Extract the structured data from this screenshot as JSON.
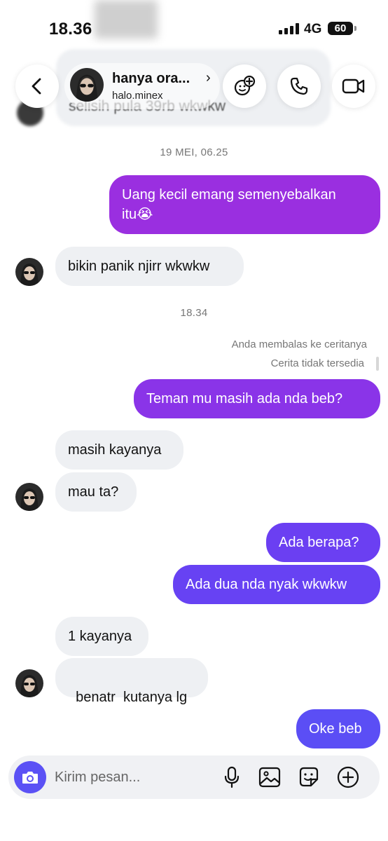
{
  "status": {
    "time": "18.36",
    "network": "4G",
    "battery": "60"
  },
  "header": {
    "name": "hanya ora...",
    "username": "halo.minex",
    "back_icon": "chevron-left-icon",
    "group_icon": "add-people-icon",
    "call_icon": "phone-icon",
    "video_icon": "video-camera-icon"
  },
  "previous_message_partial": "selisih pula 39rb wkwkw",
  "messages": {
    "ts1": "19 MEI, 06.25",
    "m1": "Uang kecil emang semenyebalkan",
    "m1b": "itu😭",
    "m2": "bikin panik njirr wkwkw",
    "ts2": "18.34",
    "note1": "Anda membalas ke ceritanya",
    "note2": "Cerita tidak tersedia",
    "m3": "Teman mu masih ada nda beb?",
    "m4": "masih kayanya",
    "m5": "mau ta?",
    "m6": "Ada berapa?",
    "m7": "Ada dua nda nyak wkwkw",
    "m8": "1 kayanya",
    "m9": "benatr  kutanya lg",
    "m10": "Oke beb"
  },
  "composer": {
    "placeholder": "Kirim pesan...",
    "camera_icon": "camera-icon",
    "mic_icon": "microphone-icon",
    "gallery_icon": "image-icon",
    "sticker_icon": "sticker-icon",
    "plus_icon": "plus-circle-icon"
  },
  "colors": {
    "outgoing_purple": "#9a2fe0",
    "outgoing_violet": "#6b3ff2",
    "outgoing_indigo": "#5b4ef5",
    "incoming_bg": "#eef0f3",
    "camera_button": "#5b51f5"
  }
}
